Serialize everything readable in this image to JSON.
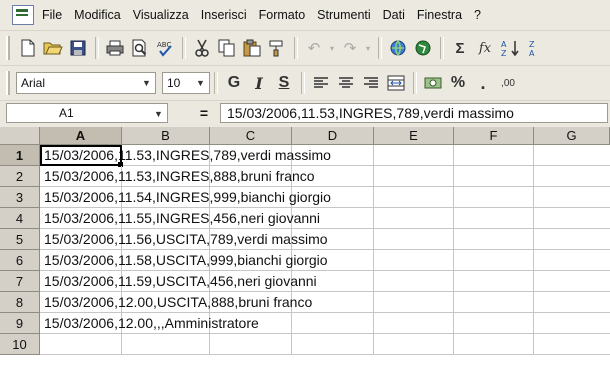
{
  "menubar": {
    "items": [
      "File",
      "Modifica",
      "Visualizza",
      "Inserisci",
      "Formato",
      "Strumenti",
      "Dati",
      "Finestra",
      "?"
    ]
  },
  "toolbar1": {
    "icons": [
      "new-icon",
      "open-icon",
      "save-icon",
      "print-icon",
      "print-preview-icon",
      "spelling-icon",
      "cut-icon",
      "copy-icon",
      "paste-icon",
      "format-painter-icon",
      "undo-icon",
      "redo-icon",
      "hyperlink-icon",
      "web-icon",
      "autosum-icon",
      "function-icon",
      "sort-ascending-icon",
      "sort-descending-icon"
    ],
    "autosum_glyph": "Σ",
    "function_glyph": "fx"
  },
  "toolbar2": {
    "font_name": "Arial",
    "font_size": "10",
    "bold": "G",
    "italic": "I",
    "underline": "S",
    "percent": "%",
    "thousands": ".",
    "increase_decimal": ",00"
  },
  "formula_bar": {
    "name_box": "A1",
    "equals": "=",
    "content": "15/03/2006,11.53,INGRES,789,verdi massimo"
  },
  "sheet": {
    "columns": [
      "A",
      "B",
      "C",
      "D",
      "E",
      "F",
      "G"
    ],
    "selected_column": "A",
    "rows": [
      {
        "num": "1",
        "a": "15/03/2006,11.53,INGRES,789,verdi massimo"
      },
      {
        "num": "2",
        "a": "15/03/2006,11.53,INGRES,888,bruni franco"
      },
      {
        "num": "3",
        "a": "15/03/2006,11.54,INGRES,999,bianchi giorgio"
      },
      {
        "num": "4",
        "a": "15/03/2006,11.55,INGRES,456,neri giovanni"
      },
      {
        "num": "5",
        "a": "15/03/2006,11.56,USCITA,789,verdi massimo"
      },
      {
        "num": "6",
        "a": "15/03/2006,11.58,USCITA,999,bianchi giorgio"
      },
      {
        "num": "7",
        "a": "15/03/2006,11.59,USCITA,456,neri giovanni"
      },
      {
        "num": "8",
        "a": "15/03/2006,12.00,USCITA,888,bruni franco"
      },
      {
        "num": "9",
        "a": "15/03/2006,12.00,,,Amministratore"
      },
      {
        "num": "10",
        "a": ""
      }
    ]
  }
}
